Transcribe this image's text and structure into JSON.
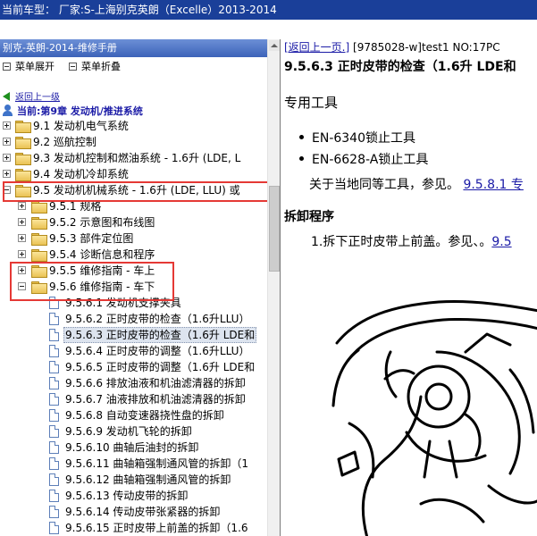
{
  "window": {
    "title": "当前车型：  厂家:S-上海别克英朗（Excelle）2013-2014"
  },
  "left": {
    "title": "别克-英朗-2014-维修手册",
    "actions": {
      "expand": "菜单展开",
      "collapse": "菜单折叠"
    },
    "back": "返回上一级",
    "current": "当前:第9章 发动机/推进系统",
    "tree": [
      {
        "label": "9.1 发动机电气系统"
      },
      {
        "label": "9.2 巡航控制"
      },
      {
        "label": "9.3 发动机控制和燃油系统 - 1.6升 (LDE, L"
      },
      {
        "label": "9.4 发动机冷却系统"
      },
      {
        "label": "9.5 发动机机械系统 - 1.6升 (LDE, LLU) 或"
      },
      {
        "label": "9.5.1 规格"
      },
      {
        "label": "9.5.2 示意图和布线图"
      },
      {
        "label": "9.5.3 部件定位图"
      },
      {
        "label": "9.5.4 诊断信息和程序"
      },
      {
        "label": "9.5.5 维修指南 - 车上"
      },
      {
        "label": "9.5.6 维修指南 - 车下"
      },
      {
        "label": "9.5.6.1 发动机支撑夹具"
      },
      {
        "label": "9.5.6.2 正时皮带的检查（1.6升LLU）"
      },
      {
        "label": "9.5.6.3 正时皮带的检查（1.6升 LDE和"
      },
      {
        "label": "9.5.6.4 正时皮带的调整（1.6升LLU）"
      },
      {
        "label": "9.5.6.5 正时皮带的调整（1.6升 LDE和"
      },
      {
        "label": "9.5.6.6 排放油液和机油滤清器的拆卸"
      },
      {
        "label": "9.5.6.7 油液排放和机油滤清器的拆卸"
      },
      {
        "label": "9.5.6.8 自动变速器挠性盘的拆卸"
      },
      {
        "label": "9.5.6.9 发动机飞轮的拆卸"
      },
      {
        "label": "9.5.6.10 曲轴后油封的拆卸"
      },
      {
        "label": "9.5.6.11 曲轴箱强制通风管的拆卸（1"
      },
      {
        "label": "9.5.6.12 曲轴箱强制通风管的拆卸"
      },
      {
        "label": "9.5.6.13 传动皮带的拆卸"
      },
      {
        "label": "9.5.6.14 传动皮带张紧器的拆卸"
      },
      {
        "label": "9.5.6.15 正时皮带上前盖的拆卸（1.6"
      }
    ]
  },
  "right": {
    "back_link": "[返回上一页.]",
    "doc_id": "[9785028-w]test1 NO:17PC",
    "title": "9.5.6.3 正时皮带的检查（1.6升 LDE和",
    "special_tools": "专用工具",
    "tools": [
      "EN-6340锁止工具",
      "EN-6628-A锁止工具"
    ],
    "equiv_text": "关于当地同等工具，参见。",
    "equiv_link": "9.5.8.1 专",
    "removal": "拆卸程序",
    "step1_text": "1.拆下正时皮带上前盖。参见、。",
    "step1_link": "9.5"
  }
}
